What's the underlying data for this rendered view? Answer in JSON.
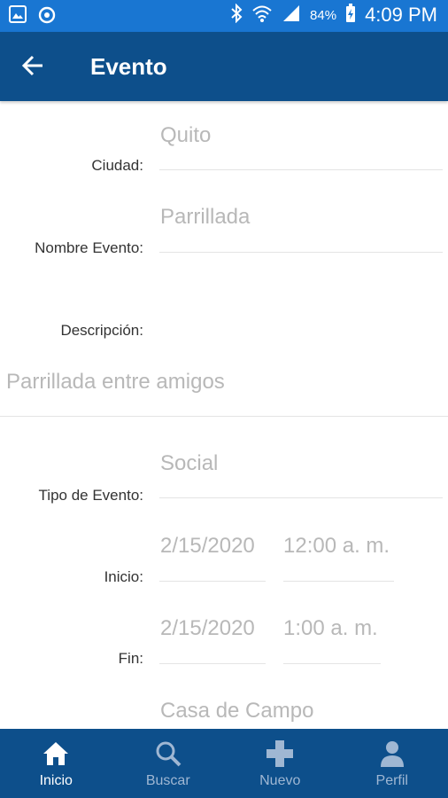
{
  "status": {
    "battery": "84%",
    "time": "4:09 PM"
  },
  "appbar": {
    "title": "Evento"
  },
  "form": {
    "ciudad": {
      "label": "Ciudad:",
      "value": "Quito"
    },
    "nombre": {
      "label": "Nombre Evento:",
      "value": "Parrillada"
    },
    "descripcion": {
      "label": "Descripción:",
      "value": "Parrillada entre amigos"
    },
    "tipo": {
      "label": "Tipo de Evento:",
      "value": "Social"
    },
    "inicio": {
      "label": "Inicio:",
      "date": "2/15/2020",
      "time": "12:00 a. m."
    },
    "fin": {
      "label": "Fin:",
      "date": "2/15/2020",
      "time": "1:00 a. m."
    },
    "lugar": {
      "value": "Casa de Campo"
    }
  },
  "nav": {
    "inicio": "Inicio",
    "buscar": "Buscar",
    "nuevo": "Nuevo",
    "perfil": "Perfil"
  },
  "colors": {
    "statusbar": "#1976d2",
    "appbar": "#0d4f8b",
    "placeholder": "#b8b8b8"
  }
}
